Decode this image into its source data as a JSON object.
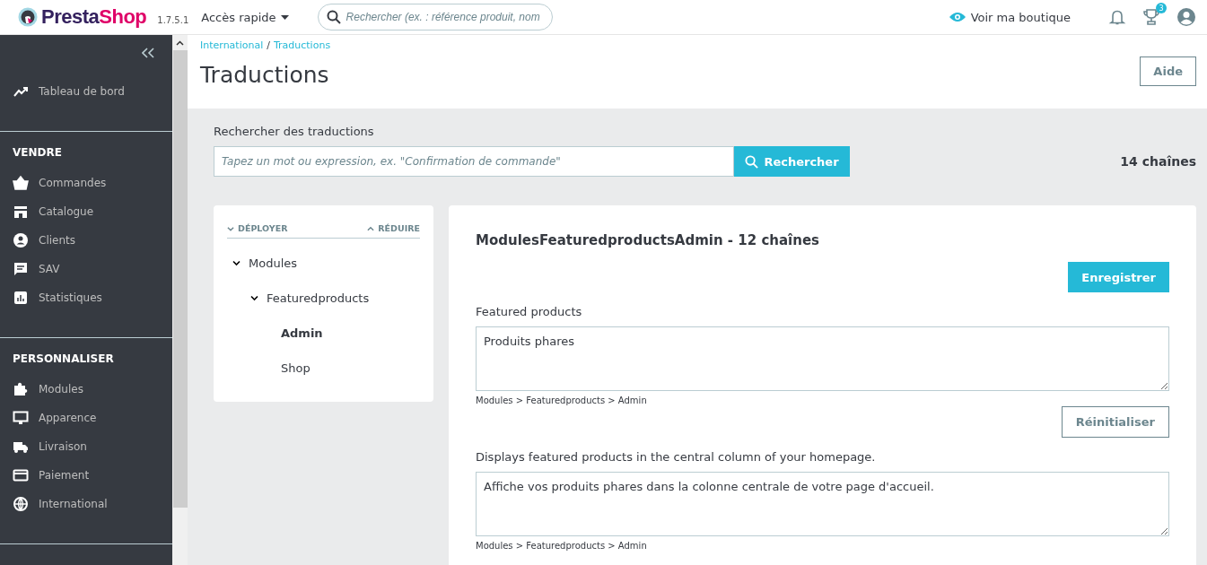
{
  "header": {
    "logo": [
      "Presta",
      "Shop"
    ],
    "version": "1.7.5.1",
    "quick_access": "Accès rapide",
    "search": {
      "placeholder": "Rechercher (ex. : référence produit, nom"
    },
    "view_shop": "Voir ma boutique",
    "notification_badge": "3"
  },
  "sidebar": {
    "top_item": {
      "label": "Tableau de bord",
      "kind": "trend"
    },
    "sections": [
      {
        "title": "VENDRE",
        "items": [
          {
            "label": "Commandes",
            "kind": "basket"
          },
          {
            "label": "Catalogue",
            "kind": "store"
          },
          {
            "label": "Clients",
            "kind": "person"
          },
          {
            "label": "SAV",
            "kind": "chat"
          },
          {
            "label": "Statistiques",
            "kind": "stats"
          }
        ]
      },
      {
        "title": "PERSONNALISER",
        "items": [
          {
            "label": "Modules",
            "kind": "puzzle"
          },
          {
            "label": "Apparence",
            "kind": "monitor"
          },
          {
            "label": "Livraison",
            "kind": "truck"
          },
          {
            "label": "Paiement",
            "kind": "card"
          },
          {
            "label": "International",
            "kind": "globe"
          }
        ]
      }
    ]
  },
  "breadcrumb": {
    "items": [
      "International",
      "Traductions"
    ],
    "separator": "/"
  },
  "page_title": "Traductions",
  "help_button": "Aide",
  "search": {
    "label": "Rechercher des traductions",
    "placeholder": "Tapez un mot ou expression, ex. \"Confirmation de commande\"",
    "button": "Rechercher",
    "count": "14 chaînes"
  },
  "tree": {
    "expand": "DÉPLOYER",
    "collapse": "RÉDUIRE",
    "nodes": [
      {
        "label": "Modules",
        "expanded": true,
        "selected": false,
        "children": [
          {
            "label": "Featuredproducts",
            "expanded": true,
            "selected": false,
            "children": [
              {
                "label": "Admin",
                "selected": true
              },
              {
                "label": "Shop",
                "selected": false
              }
            ]
          }
        ]
      }
    ]
  },
  "editor": {
    "title": "ModulesFeaturedproductsAdmin - 12 chaînes",
    "save_button": "Enregistrer",
    "entries": [
      {
        "source": "Featured products",
        "translation": "Produits phares",
        "path": "Modules > Featuredproducts > Admin",
        "reset_button": "Réinitialiser"
      },
      {
        "source": "Displays featured products in the central column of your homepage.",
        "translation": "Affiche vos produits phares dans la colonne centrale de votre page d'accueil.",
        "path": "Modules > Featuredproducts > Admin"
      }
    ]
  }
}
